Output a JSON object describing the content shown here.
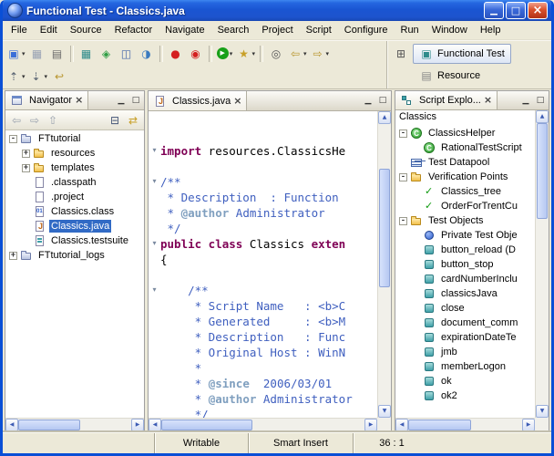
{
  "window": {
    "title": "Functional Test - Classics.java"
  },
  "menubar": {
    "items": [
      "File",
      "Edit",
      "Source",
      "Refactor",
      "Navigate",
      "Search",
      "Project",
      "Script",
      "Configure",
      "Run",
      "Window",
      "Help"
    ]
  },
  "toolbar": {
    "row1": [
      {
        "name": "new-wizard-icon",
        "glyph": "▣",
        "color": "#3a6fd8",
        "dropdown": true
      },
      {
        "name": "save-icon",
        "glyph": "▦",
        "color": "#98a2b4"
      },
      {
        "name": "print-icon",
        "glyph": "▤",
        "color": "#6a6a6a"
      },
      {
        "separator": true
      },
      {
        "name": "new-datapool-icon",
        "glyph": "▦",
        "color": "#2e8b8b"
      },
      {
        "name": "verification-point-icon",
        "glyph": "◈",
        "color": "#2f9e44"
      },
      {
        "name": "test-object-map-icon",
        "glyph": "◫",
        "color": "#4466aa"
      },
      {
        "name": "configure-environments-icon",
        "glyph": "◑",
        "color": "#3a7abf"
      },
      {
        "separator": true
      },
      {
        "name": "record-icon",
        "glyph": "●",
        "color": "#d42020"
      },
      {
        "name": "insert-recording-icon",
        "glyph": "◉",
        "color": "#d42020"
      },
      {
        "separator": true
      },
      {
        "name": "run-script-icon",
        "glyph": "▶",
        "color": "#ffffff",
        "bg": "#18a018",
        "shape": "circle",
        "dropdown": true
      },
      {
        "name": "debug-script-icon",
        "glyph": "★",
        "color": "#c8a028",
        "dropdown": true
      },
      {
        "separator": true
      },
      {
        "name": "search-icon",
        "glyph": "◎",
        "color": "#555555"
      },
      {
        "name": "back-icon",
        "glyph": "⇦",
        "color": "#b8952e",
        "dropdown": true
      },
      {
        "name": "forward-icon",
        "glyph": "⇨",
        "color": "#b8952e",
        "dropdown": true
      }
    ],
    "row2": [
      {
        "name": "previous-annotation-icon",
        "glyph": "⇡",
        "color": "#556070",
        "dropdown": true
      },
      {
        "name": "next-annotation-icon",
        "glyph": "⇣",
        "color": "#556070",
        "dropdown": true
      },
      {
        "name": "last-edit-location-icon",
        "glyph": "↩",
        "color": "#b8952e"
      }
    ],
    "perspectives": {
      "open_icon": {
        "name": "open-perspective-icon",
        "glyph": "⊞",
        "color": "#555555"
      },
      "items": [
        {
          "name": "functional-test-perspective",
          "label": "Functional Test",
          "active": true,
          "icon": {
            "glyph": "▣",
            "color": "#2e8b8b"
          }
        },
        {
          "name": "resource-perspective",
          "label": "Resource",
          "active": false,
          "icon": {
            "glyph": "▤",
            "color": "#888888"
          }
        }
      ]
    }
  },
  "navigator": {
    "title": "Navigator",
    "toolbar_left": [
      {
        "name": "back-icon",
        "glyph": "⇦",
        "color": "#9aa2ae"
      },
      {
        "name": "forward-icon",
        "glyph": "⇨",
        "color": "#9aa2ae"
      },
      {
        "name": "up-icon",
        "glyph": "⇧",
        "color": "#9aa2ae"
      }
    ],
    "toolbar_right": [
      {
        "name": "collapse-all-icon",
        "glyph": "⊟",
        "color": "#445577"
      },
      {
        "name": "link-with-editor-icon",
        "glyph": "⇄",
        "color": "#c8a028"
      }
    ],
    "tree": [
      {
        "label": "FTtutorial",
        "icon": "project",
        "expander": "minus",
        "depth": 0
      },
      {
        "label": "resources",
        "icon": "folder",
        "expander": "plus",
        "depth": 1
      },
      {
        "label": "templates",
        "icon": "folder",
        "expander": "plus",
        "depth": 1
      },
      {
        "label": ".classpath",
        "icon": "file",
        "expander": null,
        "depth": 1
      },
      {
        "label": ".project",
        "icon": "file",
        "expander": null,
        "depth": 1
      },
      {
        "label": "Classics.class",
        "icon": "class",
        "expander": null,
        "depth": 1
      },
      {
        "label": "Classics.java",
        "icon": "java",
        "expander": null,
        "depth": 1,
        "selected": true
      },
      {
        "label": "Classics.testsuite",
        "icon": "suite",
        "expander": null,
        "depth": 1
      },
      {
        "label": "FTtutorial_logs",
        "icon": "project",
        "expander": "plus",
        "depth": 0
      }
    ]
  },
  "editor": {
    "tab": "Classics.java",
    "lines": [
      {
        "segments": []
      },
      {
        "segments": []
      },
      {
        "fold": true,
        "segments": [
          {
            "text": "import",
            "style": "kw"
          },
          {
            "text": " resources.ClassicsHe",
            "style": "plain"
          }
        ]
      },
      {
        "segments": []
      },
      {
        "fold": true,
        "segments": [
          {
            "text": "/**",
            "style": "doc"
          }
        ]
      },
      {
        "segments": [
          {
            "text": " * Description  : Function",
            "style": "doc"
          }
        ]
      },
      {
        "segments": [
          {
            "text": " * ",
            "style": "doc"
          },
          {
            "text": "@author",
            "style": "tag"
          },
          {
            "text": " Administrator",
            "style": "doc"
          }
        ]
      },
      {
        "segments": [
          {
            "text": " */",
            "style": "doc"
          }
        ]
      },
      {
        "fold": true,
        "segments": [
          {
            "text": "public class ",
            "style": "kw"
          },
          {
            "text": "Classics ",
            "style": "plain"
          },
          {
            "text": "exten",
            "style": "kw"
          }
        ]
      },
      {
        "segments": [
          {
            "text": "{",
            "style": "plain"
          }
        ]
      },
      {
        "segments": []
      },
      {
        "fold": true,
        "segments": [
          {
            "text": "    /**",
            "style": "doc"
          }
        ]
      },
      {
        "segments": [
          {
            "text": "     * Script Name   : <b>C",
            "style": "doc"
          }
        ]
      },
      {
        "segments": [
          {
            "text": "     * Generated     : <b>M",
            "style": "doc"
          }
        ]
      },
      {
        "segments": [
          {
            "text": "     * Description   : Func",
            "style": "doc"
          }
        ]
      },
      {
        "segments": [
          {
            "text": "     * Original Host : WinN",
            "style": "doc"
          }
        ]
      },
      {
        "segments": [
          {
            "text": "     *",
            "style": "doc"
          }
        ]
      },
      {
        "segments": [
          {
            "text": "     * ",
            "style": "doc"
          },
          {
            "text": "@since",
            "style": "tag"
          },
          {
            "text": "  2006/03/01",
            "style": "doc"
          }
        ]
      },
      {
        "segments": [
          {
            "text": "     * ",
            "style": "doc"
          },
          {
            "text": "@author",
            "style": "tag"
          },
          {
            "text": " Administrator",
            "style": "doc"
          }
        ]
      },
      {
        "segments": [
          {
            "text": "     */",
            "style": "doc"
          }
        ]
      }
    ]
  },
  "script_explorer": {
    "title": "Script Explo...",
    "root_label": "Classics",
    "tree": [
      {
        "label": "ClassicsHelper",
        "icon": "green-class",
        "expander": "minus",
        "depth": 0
      },
      {
        "label": "RationalTestScript",
        "icon": "green-class",
        "expander": null,
        "depth": 1
      },
      {
        "label": "Test Datapool",
        "icon": "datapool",
        "expander": null,
        "depth": 0
      },
      {
        "label": "Verification Points",
        "icon": "folder",
        "expander": "minus",
        "depth": 0
      },
      {
        "label": "Classics_tree",
        "icon": "check",
        "expander": null,
        "depth": 1
      },
      {
        "label": "OrderForTrentCu",
        "icon": "check",
        "expander": null,
        "depth": 1
      },
      {
        "label": "Test Objects",
        "icon": "folder",
        "expander": "minus",
        "depth": 0
      },
      {
        "label": "Private Test Obje",
        "icon": "pobj",
        "expander": null,
        "depth": 1
      },
      {
        "label": "button_reload (D",
        "icon": "tobj",
        "expander": null,
        "depth": 1
      },
      {
        "label": "button_stop",
        "icon": "tobj",
        "expander": null,
        "depth": 1
      },
      {
        "label": "cardNumberInclu",
        "icon": "tobj",
        "expander": null,
        "depth": 1
      },
      {
        "label": "classicsJava",
        "icon": "tobj",
        "expander": null,
        "depth": 1
      },
      {
        "label": "close",
        "icon": "tobj",
        "expander": null,
        "depth": 1
      },
      {
        "label": "document_comm",
        "icon": "tobj",
        "expander": null,
        "depth": 1
      },
      {
        "label": "expirationDateTe",
        "icon": "tobj",
        "expander": null,
        "depth": 1
      },
      {
        "label": "jmb",
        "icon": "tobj",
        "expander": null,
        "depth": 1
      },
      {
        "label": "memberLogon",
        "icon": "tobj",
        "expander": null,
        "depth": 1
      },
      {
        "label": "ok",
        "icon": "tobj",
        "expander": null,
        "depth": 1
      },
      {
        "label": "ok2",
        "icon": "tobj",
        "expander": null,
        "depth": 1
      }
    ]
  },
  "statusbar": {
    "writable": "Writable",
    "insert_mode": "Smart Insert",
    "position": "36 : 1"
  }
}
